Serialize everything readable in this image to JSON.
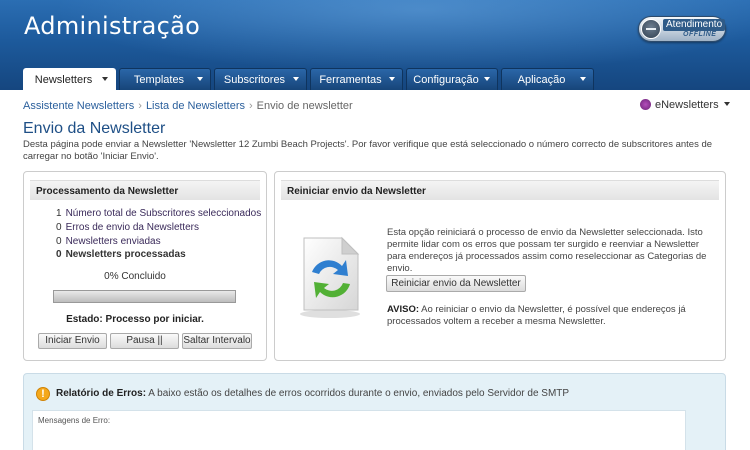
{
  "header": {
    "title": "Administração",
    "support_label": "Atendimento",
    "support_status": "OFFLINE"
  },
  "nav": {
    "tabs": [
      {
        "label": "Newsletters",
        "active": true
      },
      {
        "label": "Templates",
        "active": false
      },
      {
        "label": "Subscritores",
        "active": false
      },
      {
        "label": "Ferramentas",
        "active": false
      },
      {
        "label": "Configuração",
        "active": false
      },
      {
        "label": "Aplicação",
        "active": false
      }
    ]
  },
  "breadcrumb": {
    "items": [
      "Assistente Newsletters",
      "Lista de Newsletters",
      "Envio de newsletter"
    ],
    "separator": "›"
  },
  "user_menu": {
    "label": "eNewsletters"
  },
  "page": {
    "title": "Envio da Newsletter",
    "intro": "Desta página pode enviar a Newsletter 'Newsletter 12 Zumbi Beach Projects'. Por favor verifique que está seleccionado o número correcto de subscritores antes de carregar no botão 'Iniciar Envio'."
  },
  "processing": {
    "title": "Processamento da Newsletter",
    "stats": [
      {
        "value": "1",
        "label": "Número total de Subscritores seleccionados"
      },
      {
        "value": "0",
        "label": "Erros de envio da Newsletters"
      },
      {
        "value": "0",
        "label": "Newsletters enviadas"
      },
      {
        "value": "0",
        "label": "Newsletters processadas"
      }
    ],
    "percent_text": "0% Concluido",
    "progress": 0,
    "status_text": "Estado: Processo por iniciar.",
    "buttons": {
      "start": "Iniciar Envio",
      "pause": "Pausa ||",
      "skip": "Saltar Intervalo"
    }
  },
  "restart": {
    "title": "Reiniciar envio da Newsletter",
    "description": "Esta opção reiniciará o processo de envio da Newsletter seleccionada. Isto permite lidar com os erros que possam ter surgido e reenviar a Newsletter para endereços já processados assim como reseleccionar as Categorias de envio.",
    "button": "Reiniciar envio da Newsletter",
    "warning_label": "AVISO:",
    "warning_text": " Ao reiniciar o envio da Newsletter, é possível que endereços já processados voltem a receber a mesma Newsletter."
  },
  "error_report": {
    "label": "Relatório de Erros:",
    "text": " A baixo estão os detalhes de erros ocorridos durante o envio, enviados pelo Servidor de SMTP",
    "messages_label": "Mensagens de Erro:"
  },
  "icons": {
    "warning": "!"
  },
  "colors": {
    "header_blue": "#1d5a9c",
    "link_blue": "#2a5f9c",
    "title_blue": "#1e4f86",
    "report_bg": "#e4f1f7",
    "warning_orange": "#f4a81d"
  }
}
